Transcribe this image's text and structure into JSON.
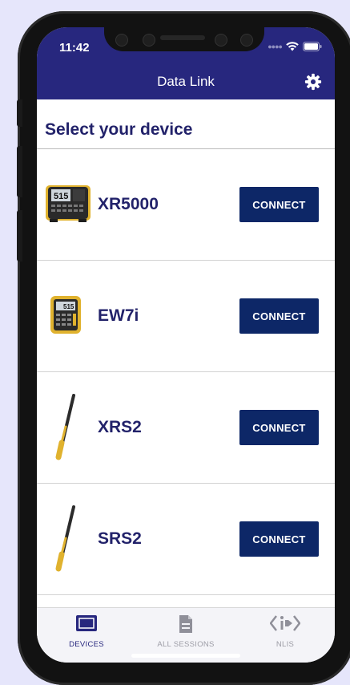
{
  "status_bar": {
    "time": "11:42"
  },
  "header": {
    "title": "Data Link"
  },
  "section_title": "Select your device",
  "devices": [
    {
      "name": "XR5000",
      "connect_label": "CONNECT",
      "screen_text": "515"
    },
    {
      "name": "EW7i",
      "connect_label": "CONNECT",
      "screen_text": "515"
    },
    {
      "name": "XRS2",
      "connect_label": "CONNECT"
    },
    {
      "name": "SRS2",
      "connect_label": "CONNECT"
    }
  ],
  "tabs": [
    {
      "label": "DEVICES",
      "icon": "devices-icon",
      "active": true
    },
    {
      "label": "ALL SESSIONS",
      "icon": "document-icon",
      "active": false
    },
    {
      "label": "NLIS",
      "icon": "nlis-icon",
      "active": false
    }
  ],
  "colors": {
    "header": "#27277e",
    "button": "#0d2767",
    "text": "#22226a",
    "tab_active": "#27277e",
    "tab_inactive": "#9d9da6",
    "background": "#e6e6fb"
  }
}
